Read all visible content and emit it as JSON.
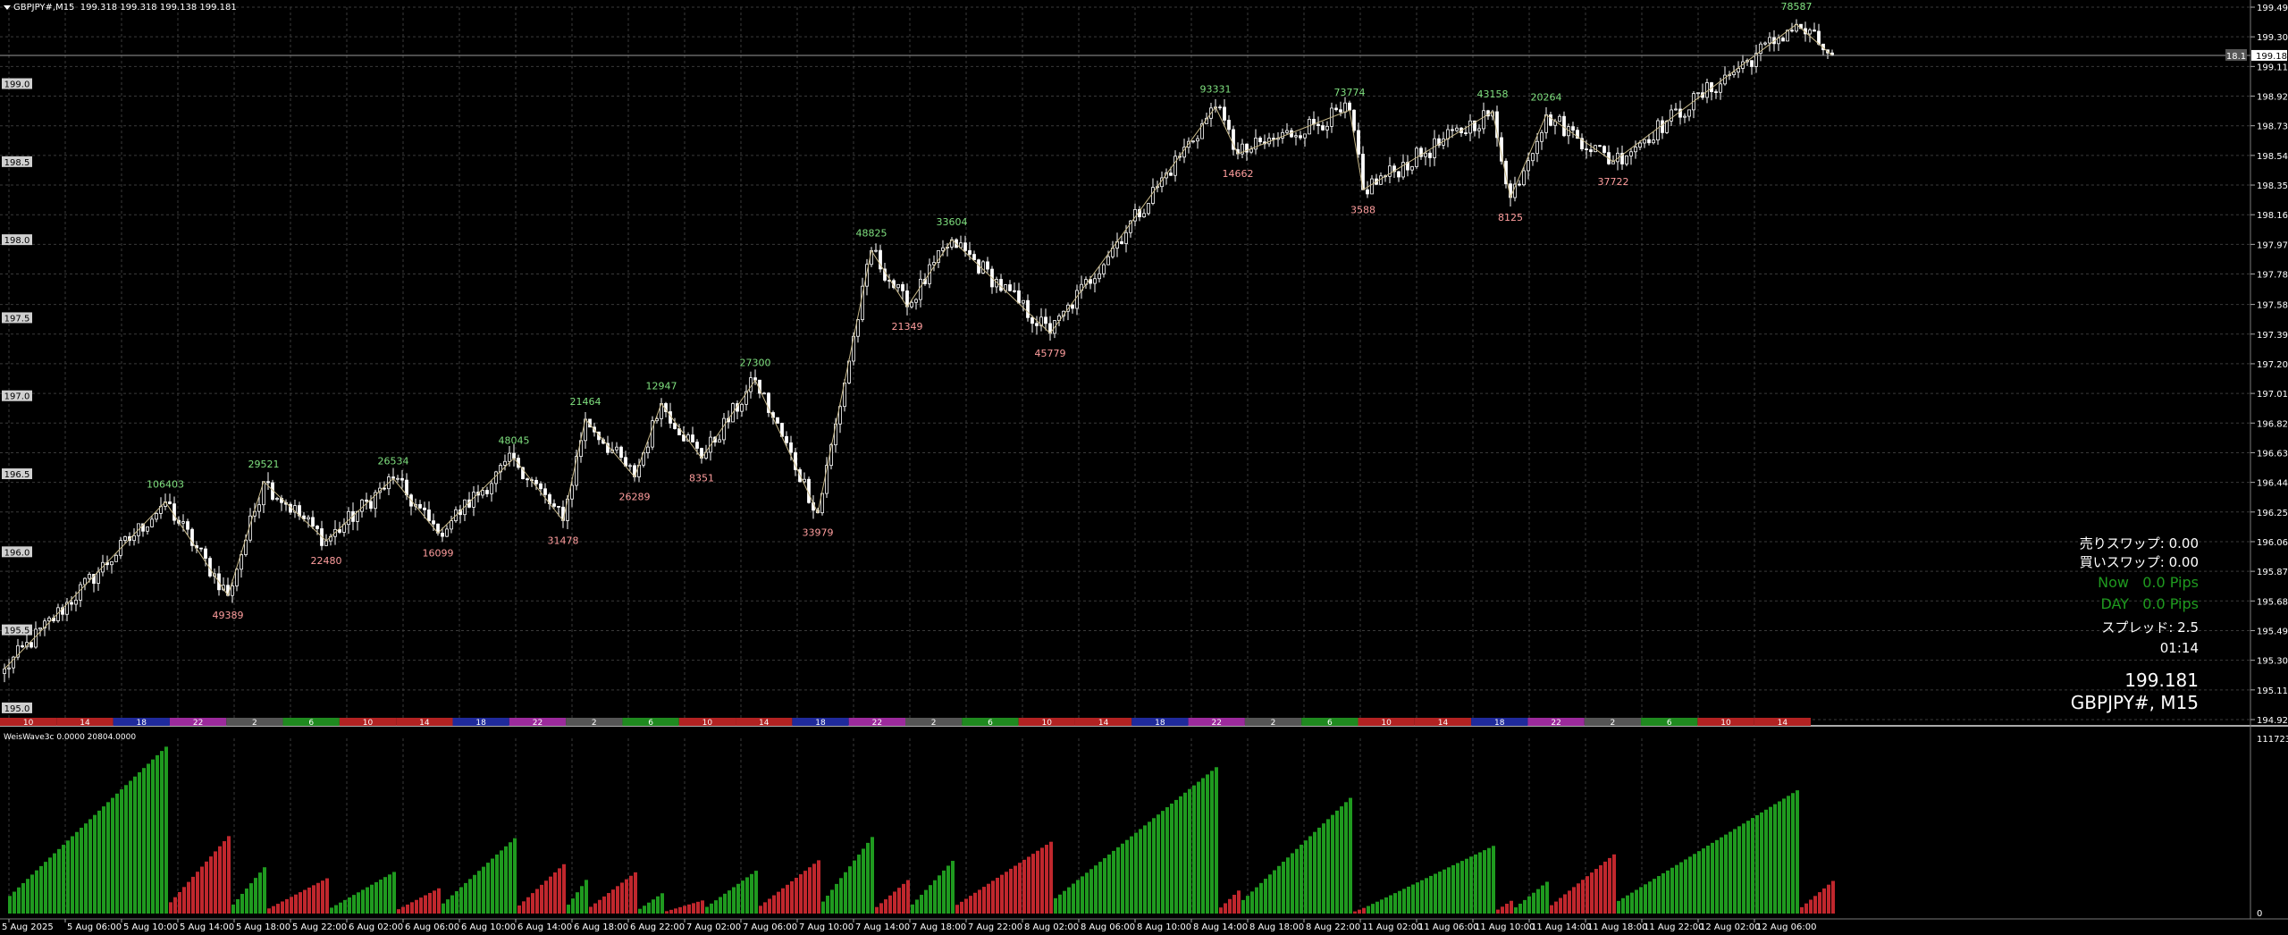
{
  "header": {
    "symbol_tf": "GBPJPY#,M15",
    "ohlc": "199.318 199.318 199.138 199.181"
  },
  "indicator": {
    "name": "WeisWave3c 0.0000 20804.0000",
    "scale_max": "111723.15",
    "scale_zero": "0"
  },
  "info_panel": {
    "sell_swap": "売りスワップ: 0.00",
    "buy_swap": "買いスワップ: 0.00",
    "now_pips": "Now   0.0 Pips",
    "day_pips": "DAY   0.0 Pips",
    "spread": "スプレッド: 2.5",
    "timer": "01:14",
    "price": "199.181",
    "symbol": "GBPJPY#, M15"
  },
  "colors": {
    "background": "#000000",
    "grid": "#3a3a3a",
    "candles": "#ffffff",
    "zigzag": "#c8b98a",
    "up_label": "#7fe07f",
    "down_label": "#ff9e9e",
    "volume_up": "#1f9a1f",
    "volume_down": "#c0272d",
    "bid_line": "#9a9a9a"
  },
  "chart_data": {
    "type": "candlestick",
    "title": "GBPJPY#, M15",
    "y_ticks": [
      "199.490",
      "199.300",
      "199.110",
      "198.920",
      "198.730",
      "198.540",
      "198.350",
      "198.160",
      "197.970",
      "197.780",
      "197.585",
      "197.395",
      "197.205",
      "197.015",
      "196.825",
      "196.635",
      "196.445",
      "196.255",
      "196.065",
      "195.875",
      "195.685",
      "195.495",
      "195.305",
      "195.115",
      "194.925"
    ],
    "left_levels": [
      "199.5",
      "199.0",
      "198.5",
      "198.0",
      "197.5",
      "197.0",
      "196.5",
      "196.0",
      "195.5",
      "195.0"
    ],
    "ylim": [
      194.925,
      199.49
    ],
    "current_price": "199.181",
    "spread_badge": "18.1",
    "x_labels": [
      "5 Aug 2025",
      "5 Aug 06:00",
      "5 Aug 10:00",
      "5 Aug 14:00",
      "5 Aug 18:00",
      "5 Aug 22:00",
      "6 Aug 02:00",
      "6 Aug 06:00",
      "6 Aug 10:00",
      "6 Aug 14:00",
      "6 Aug 18:00",
      "6 Aug 22:00",
      "7 Aug 02:00",
      "7 Aug 06:00",
      "7 Aug 10:00",
      "7 Aug 14:00",
      "7 Aug 18:00",
      "7 Aug 22:00",
      "8 Aug 02:00",
      "8 Aug 06:00",
      "8 Aug 10:00",
      "8 Aug 14:00",
      "8 Aug 18:00",
      "8 Aug 22:00",
      "11 Aug 02:00",
      "11 Aug 06:00",
      "11 Aug 10:00",
      "11 Aug 14:00",
      "11 Aug 18:00",
      "11 Aug 22:00",
      "12 Aug 02:00",
      "12 Aug 06:00"
    ],
    "session_bar": [
      {
        "label": "10",
        "color": "#b22222"
      },
      {
        "label": "14",
        "color": "#b22222"
      },
      {
        "label": "18",
        "color": "#1f2a9c"
      },
      {
        "label": "22",
        "color": "#9c2a9c"
      },
      {
        "label": "2",
        "color": "#555555"
      },
      {
        "label": "6",
        "color": "#1f8a1f"
      },
      {
        "label": "10",
        "color": "#b22222"
      },
      {
        "label": "14",
        "color": "#b22222"
      },
      {
        "label": "18",
        "color": "#1f2a9c"
      },
      {
        "label": "22",
        "color": "#9c2a9c"
      },
      {
        "label": "2",
        "color": "#555555"
      },
      {
        "label": "6",
        "color": "#1f8a1f"
      },
      {
        "label": "10",
        "color": "#b22222"
      },
      {
        "label": "14",
        "color": "#b22222"
      },
      {
        "label": "18",
        "color": "#1f2a9c"
      },
      {
        "label": "22",
        "color": "#9c2a9c"
      },
      {
        "label": "2",
        "color": "#555555"
      },
      {
        "label": "6",
        "color": "#1f8a1f"
      },
      {
        "label": "10",
        "color": "#b22222"
      },
      {
        "label": "14",
        "color": "#b22222"
      },
      {
        "label": "18",
        "color": "#1f2a9c"
      },
      {
        "label": "22",
        "color": "#9c2a9c"
      },
      {
        "label": "2",
        "color": "#555555"
      },
      {
        "label": "6",
        "color": "#1f8a1f"
      },
      {
        "label": "10",
        "color": "#b22222"
      },
      {
        "label": "14",
        "color": "#b22222"
      },
      {
        "label": "18",
        "color": "#1f2a9c"
      },
      {
        "label": "22",
        "color": "#9c2a9c"
      },
      {
        "label": "2",
        "color": "#555555"
      },
      {
        "label": "6",
        "color": "#1f8a1f"
      },
      {
        "label": "10",
        "color": "#b22222"
      },
      {
        "label": "14",
        "color": "#b22222"
      }
    ],
    "zigzag": [
      {
        "i": 0,
        "price": 195.25
      },
      {
        "i": 36,
        "price": 196.32,
        "label": "106403",
        "dir": "up"
      },
      {
        "i": 50,
        "price": 195.72,
        "label": "49389",
        "dir": "down"
      },
      {
        "i": 58,
        "price": 196.45,
        "label": "29521",
        "dir": "up"
      },
      {
        "i": 72,
        "price": 196.07,
        "label": "22480",
        "dir": "down"
      },
      {
        "i": 87,
        "price": 196.47,
        "label": "26534",
        "dir": "up"
      },
      {
        "i": 97,
        "price": 196.12,
        "label": "16099",
        "dir": "down"
      },
      {
        "i": 114,
        "price": 196.6,
        "label": "48045",
        "dir": "up"
      },
      {
        "i": 125,
        "price": 196.2,
        "label": "31478",
        "dir": "down"
      },
      {
        "i": 130,
        "price": 196.85,
        "label": "21464",
        "dir": "up"
      },
      {
        "i": 141,
        "price": 196.48,
        "label": "26289",
        "dir": "down"
      },
      {
        "i": 147,
        "price": 196.95,
        "label": "12947",
        "dir": "up"
      },
      {
        "i": 156,
        "price": 196.6,
        "label": "8351",
        "dir": "down"
      },
      {
        "i": 168,
        "price": 197.1,
        "label": "27300",
        "dir": "up"
      },
      {
        "i": 182,
        "price": 196.25,
        "label": "33979",
        "dir": "down"
      },
      {
        "i": 194,
        "price": 197.93,
        "label": "48825",
        "dir": "up"
      },
      {
        "i": 202,
        "price": 197.57,
        "label": "21349",
        "dir": "down"
      },
      {
        "i": 212,
        "price": 198.0,
        "label": "33604",
        "dir": "up"
      },
      {
        "i": 234,
        "price": 197.4,
        "label": "45779",
        "dir": "down"
      },
      {
        "i": 271,
        "price": 198.85,
        "label": "93331",
        "dir": "up"
      },
      {
        "i": 276,
        "price": 198.55,
        "label": "14662",
        "dir": "down"
      },
      {
        "i": 301,
        "price": 198.83,
        "label": "73774",
        "dir": "up"
      },
      {
        "i": 304,
        "price": 198.32,
        "label": "3588",
        "dir": "down"
      },
      {
        "i": 333,
        "price": 198.82,
        "label": "43158",
        "dir": "up"
      },
      {
        "i": 337,
        "price": 198.27,
        "label": "8125",
        "dir": "down"
      },
      {
        "i": 345,
        "price": 198.8,
        "label": "20264",
        "dir": "up"
      },
      {
        "i": 360,
        "price": 198.5,
        "label": "37722",
        "dir": "down"
      },
      {
        "i": 401,
        "price": 199.38,
        "label": "78587",
        "dir": "up"
      },
      {
        "i": 409,
        "price": 199.18
      }
    ],
    "volume_waves": [
      {
        "from": 0,
        "to": 36,
        "dir": "up",
        "peak": 106403
      },
      {
        "from": 36,
        "to": 50,
        "dir": "down",
        "peak": 49389
      },
      {
        "from": 50,
        "to": 58,
        "dir": "up",
        "peak": 29521
      },
      {
        "from": 58,
        "to": 72,
        "dir": "down",
        "peak": 22480
      },
      {
        "from": 72,
        "to": 87,
        "dir": "up",
        "peak": 26534
      },
      {
        "from": 87,
        "to": 97,
        "dir": "down",
        "peak": 16099
      },
      {
        "from": 97,
        "to": 114,
        "dir": "up",
        "peak": 48045
      },
      {
        "from": 114,
        "to": 125,
        "dir": "down",
        "peak": 31478
      },
      {
        "from": 125,
        "to": 130,
        "dir": "up",
        "peak": 21464
      },
      {
        "from": 130,
        "to": 141,
        "dir": "down",
        "peak": 26289
      },
      {
        "from": 141,
        "to": 147,
        "dir": "up",
        "peak": 12947
      },
      {
        "from": 147,
        "to": 156,
        "dir": "down",
        "peak": 8351
      },
      {
        "from": 156,
        "to": 168,
        "dir": "up",
        "peak": 27300
      },
      {
        "from": 168,
        "to": 182,
        "dir": "down",
        "peak": 33979
      },
      {
        "from": 182,
        "to": 194,
        "dir": "up",
        "peak": 48825
      },
      {
        "from": 194,
        "to": 202,
        "dir": "down",
        "peak": 21349
      },
      {
        "from": 202,
        "to": 212,
        "dir": "up",
        "peak": 33604
      },
      {
        "from": 212,
        "to": 234,
        "dir": "down",
        "peak": 45779
      },
      {
        "from": 234,
        "to": 271,
        "dir": "up",
        "peak": 93331
      },
      {
        "from": 271,
        "to": 276,
        "dir": "down",
        "peak": 14662
      },
      {
        "from": 276,
        "to": 301,
        "dir": "up",
        "peak": 73774
      },
      {
        "from": 301,
        "to": 304,
        "dir": "down",
        "peak": 3588
      },
      {
        "from": 304,
        "to": 333,
        "dir": "up",
        "peak": 43158
      },
      {
        "from": 333,
        "to": 337,
        "dir": "down",
        "peak": 8125
      },
      {
        "from": 337,
        "to": 345,
        "dir": "up",
        "peak": 20264
      },
      {
        "from": 345,
        "to": 360,
        "dir": "down",
        "peak": 37722
      },
      {
        "from": 360,
        "to": 401,
        "dir": "up",
        "peak": 78587
      },
      {
        "from": 401,
        "to": 409,
        "dir": "down",
        "peak": 20804
      }
    ],
    "bar_count": 410,
    "grid": true
  }
}
